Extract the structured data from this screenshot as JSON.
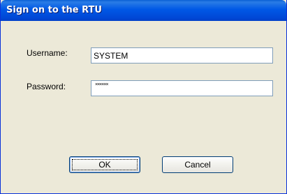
{
  "dialog": {
    "title": "Sign on to the RTU"
  },
  "form": {
    "username_label": "Username:",
    "username_value": "SYSTEM",
    "password_label": "Password:",
    "password_mask": "××××××"
  },
  "buttons": {
    "ok_label": "OK",
    "cancel_label": "Cancel"
  }
}
